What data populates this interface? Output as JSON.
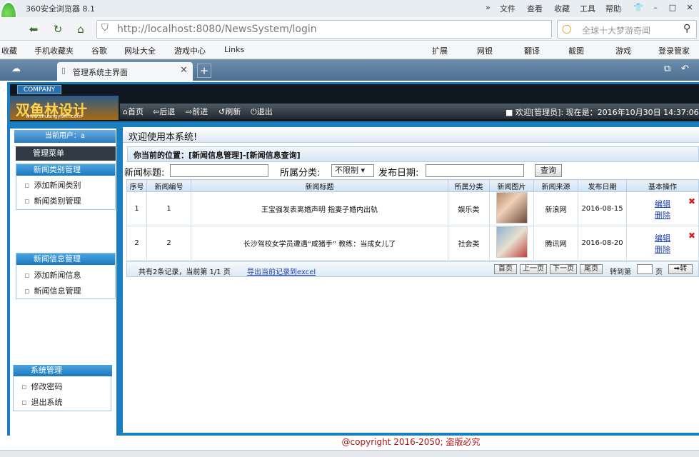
{
  "browser": {
    "title": "360安全浏览器 8.1",
    "menus": [
      "文件",
      "查看",
      "收藏",
      "工具",
      "帮助"
    ],
    "address": "http://localhost:8080/NewsSystem/login",
    "search_placeholder": "全球十大梦游奇闻",
    "bookmarks": [
      "收藏",
      "手机收藏夹",
      "谷歌",
      "网址大全",
      "游戏中心",
      "Links"
    ],
    "extensions": [
      "扩展",
      "网银",
      "翻译",
      "截图",
      "游戏",
      "登录管家"
    ],
    "tab_label": "管理系统主界面"
  },
  "app": {
    "company": "COMPANY",
    "logo_text": "双鱼林设计",
    "logo_sub": "www.shuangyulin.com",
    "toolbar": [
      "首页",
      "后退",
      "前进",
      "刷新",
      "退出"
    ],
    "welcome": "欢迎[管理员]:  现在是：2016年10月30日 14:37:06",
    "current_user": "当前用户：a",
    "menu_title": "管理菜单",
    "groups": [
      {
        "title": "新闻类别管理",
        "items": [
          "添加新闻类别",
          "新闻类别管理"
        ]
      },
      {
        "title": "新闻信息管理",
        "items": [
          "添加新闻信息",
          "新闻信息管理"
        ]
      },
      {
        "title": "系统管理",
        "items": [
          "修改密码",
          "退出系统"
        ]
      }
    ],
    "welcome_msg": "欢迎使用本系统!",
    "breadcrumb": "你当前的位置：[新闻信息管理]-[新闻信息查询]",
    "filter": {
      "title_label": "新闻标题:",
      "category_label": "所属分类:",
      "category_value": "不限制",
      "date_label": "发布日期:",
      "query_button": "查询"
    },
    "table": {
      "headers": [
        "序号",
        "新闻编号",
        "新闻标题",
        "所属分类",
        "新闻图片",
        "新闻来源",
        "发布日期",
        "基本操作"
      ],
      "rows": [
        {
          "seq": "1",
          "id": "1",
          "title": "王宝强发表离婚声明 指妻子婚内出轨",
          "category": "娱乐类",
          "source": "新浪网",
          "date": "2016-08-15",
          "edit": "编辑",
          "del": "删除"
        },
        {
          "seq": "2",
          "id": "2",
          "title": "长沙驾校女学员遭遇“咸猪手” 教练：当成女儿了",
          "category": "社会类",
          "source": "腾讯网",
          "date": "2016-08-20",
          "edit": "编辑",
          "del": "删除"
        }
      ]
    },
    "pager": {
      "info": "共有2条记录，当前第 1/1 页",
      "export": "导出当前记录到excel",
      "first": "首页",
      "prev": "上一页",
      "next": "下一页",
      "last": "尾页",
      "goto": "转到第",
      "page_unit": "页",
      "go": "转"
    },
    "footer": "@copyright 2016-2050; 盗版必究"
  }
}
